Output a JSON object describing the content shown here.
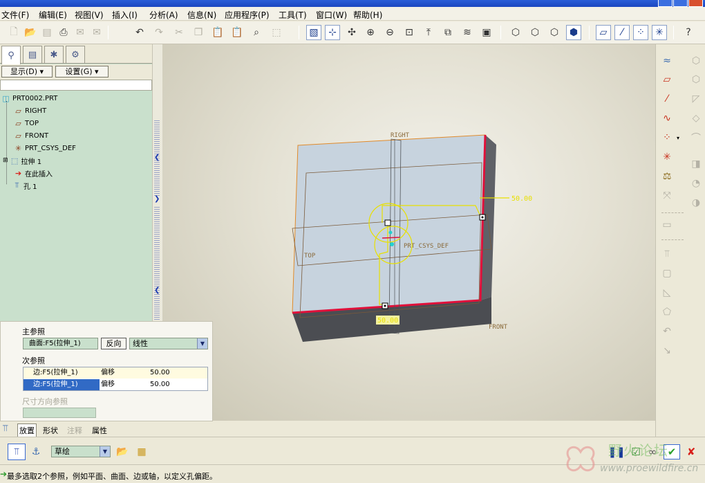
{
  "menu": [
    "文件(F)",
    "编辑(E)",
    "视图(V)",
    "插入(I)",
    "分析(A)",
    "信息(N)",
    "应用程序(P)",
    "工具(T)",
    "窗口(W)",
    "帮助(H)"
  ],
  "panel": {
    "show_label": "显示(D)",
    "settings_label": "设置(G)"
  },
  "tree": {
    "root": "PRT0002.PRT",
    "items": [
      "RIGHT",
      "TOP",
      "FRONT",
      "PRT_CSYS_DEF",
      "拉伸 1",
      "在此插入",
      "孔 1"
    ]
  },
  "model": {
    "label_right": "RIGHT",
    "label_top": "TOP",
    "label_front": "FRONT",
    "label_csys": "PRT_CSYS_DEF",
    "dim1": "50.00",
    "dim2": "50.00"
  },
  "dash": {
    "primary_title": "主参照",
    "primary_ref": "曲面:F5(拉伸_1)",
    "flip_label": "反向",
    "placement_type": "线性",
    "secondary_title": "次参照",
    "secondary_refs": [
      {
        "ref": "边:F5(拉伸_1)",
        "type": "偏移",
        "value": "50.00"
      },
      {
        "ref": "边:F5(拉伸_1)",
        "type": "偏移",
        "value": "50.00"
      }
    ],
    "dir_title": "尺寸方向参照"
  },
  "bottom_tabs": [
    "放置",
    "形状",
    "注释",
    "属性"
  ],
  "dashbar": {
    "sketch_option": "草绘"
  },
  "status": "最多选取2个参照，例如平面、曲面、边或轴，以定义孔偏距。",
  "watermark": {
    "cn": "野火论坛",
    "url": "www.proewildfire.cn"
  }
}
